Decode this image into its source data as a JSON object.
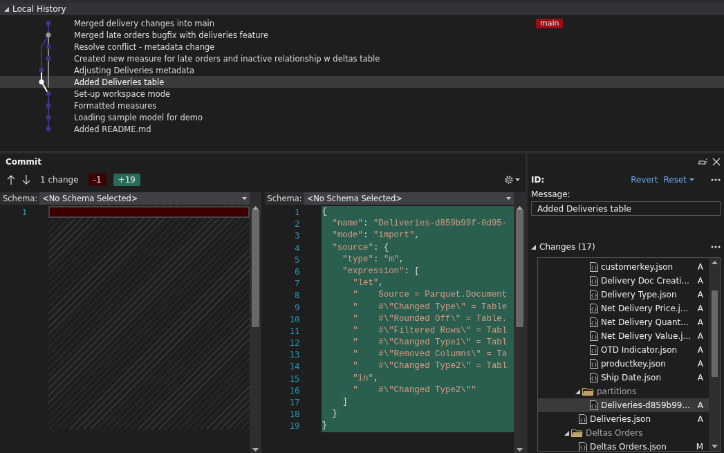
{
  "history": {
    "title": "Local History",
    "expanded": true,
    "commits": [
      {
        "message": "Merged delivery changes into main",
        "selected": false,
        "on_branch": false,
        "kind": "commit",
        "badge": "main"
      },
      {
        "message": "Merged late orders bugfix with deliveries feature",
        "selected": false,
        "on_branch": false,
        "kind": "merge"
      },
      {
        "message": "Resolve conflict - metadata change",
        "selected": false,
        "on_branch": false,
        "kind": "commit"
      },
      {
        "message": "Created new measure for late orders and inactive relationship w deltas table",
        "selected": false,
        "on_branch": false,
        "kind": "commit"
      },
      {
        "message": "Adjusting Deliveries metadata",
        "selected": false,
        "on_branch": true,
        "kind": "commit"
      },
      {
        "message": "Added Deliveries table",
        "selected": true,
        "on_branch": true,
        "kind": "commit"
      },
      {
        "message": "Set-up workspace mode",
        "selected": false,
        "on_branch": false,
        "kind": "commit"
      },
      {
        "message": "Formatted measures",
        "selected": false,
        "on_branch": false,
        "kind": "commit"
      },
      {
        "message": "Loading sample model for demo",
        "selected": false,
        "on_branch": false,
        "kind": "commit"
      },
      {
        "message": "Added README.md",
        "selected": false,
        "on_branch": false,
        "kind": "commit"
      }
    ]
  },
  "commit": {
    "title": "Commit",
    "change_count": "1 change",
    "removed": "-1",
    "added": "+19"
  },
  "diff": {
    "left": {
      "schema_label": "Schema:",
      "schema": "<No Schema Selected>",
      "lines": [
        {
          "number": "1",
          "kind": "removed"
        }
      ]
    },
    "right": {
      "schema_label": "Schema:",
      "schema": "<No Schema Selected>",
      "lines": [
        {
          "number": "1",
          "kind": "added",
          "text": "{"
        },
        {
          "number": "2",
          "kind": "added",
          "text": "  \"name\": \"Deliveries-d859b99f-0d95-"
        },
        {
          "number": "3",
          "kind": "added",
          "text": "  \"mode\": \"import\","
        },
        {
          "number": "4",
          "kind": "added",
          "text": "  \"source\": {"
        },
        {
          "number": "5",
          "kind": "added",
          "text": "    \"type\": \"m\","
        },
        {
          "number": "6",
          "kind": "added",
          "text": "    \"expression\": ["
        },
        {
          "number": "7",
          "kind": "added",
          "text": "      \"let\","
        },
        {
          "number": "8",
          "kind": "added",
          "text": "      \"    Source = Parquet.Document"
        },
        {
          "number": "9",
          "kind": "added",
          "text": "      \"    #\\\"Changed Type\\\" = Table"
        },
        {
          "number": "10",
          "kind": "added",
          "text": "      \"    #\\\"Rounded Off\\\" = Table."
        },
        {
          "number": "11",
          "kind": "added",
          "text": "      \"    #\\\"Filtered Rows\\\" = Tabl"
        },
        {
          "number": "12",
          "kind": "added",
          "text": "      \"    #\\\"Changed Type1\\\" = Tabl"
        },
        {
          "number": "13",
          "kind": "added",
          "text": "      \"    #\\\"Removed Columns\\\" = Ta"
        },
        {
          "number": "14",
          "kind": "added",
          "text": "      \"    #\\\"Changed Type2\\\" = Tabl"
        },
        {
          "number": "15",
          "kind": "added",
          "text": "      \"in\","
        },
        {
          "number": "16",
          "kind": "added",
          "text": "      \"    #\\\"Changed Type2\\\"\""
        },
        {
          "number": "17",
          "kind": "added",
          "text": "    ]"
        },
        {
          "number": "18",
          "kind": "added",
          "text": "  }"
        },
        {
          "number": "19",
          "kind": "added",
          "text": "}"
        }
      ]
    }
  },
  "details": {
    "id_label": "ID:",
    "revert": "Revert",
    "reset": "Reset",
    "message_label": "Message:",
    "message": "Added Deliveries table",
    "changes_title": "Changes (17)",
    "changes_expanded": true,
    "tree": [
      {
        "kind": "hidden-folder",
        "children": [
          {
            "kind": "hidden-folder",
            "children": [
              {
                "kind": "file",
                "name": "customerkey.json",
                "status": "A",
                "selected": false
              },
              {
                "kind": "file",
                "name": "Delivery Doc Creati...",
                "status": "A",
                "selected": false
              },
              {
                "kind": "file",
                "name": "Delivery Type.json",
                "status": "A",
                "selected": false
              },
              {
                "kind": "file",
                "name": "Net Delivery Price.j...",
                "status": "A",
                "selected": false
              },
              {
                "kind": "file",
                "name": "Net Delivery Quant...",
                "status": "A",
                "selected": false
              },
              {
                "kind": "file",
                "name": "Net Delivery Value.j...",
                "status": "A",
                "selected": false
              },
              {
                "kind": "file",
                "name": "OTD Indicator.json",
                "status": "A",
                "selected": false
              },
              {
                "kind": "file",
                "name": "productkey.json",
                "status": "A",
                "selected": false
              },
              {
                "kind": "file",
                "name": "Ship Date.json",
                "status": "A",
                "selected": false
              }
            ]
          },
          {
            "kind": "folder",
            "name": "partitions",
            "expanded": true,
            "children": [
              {
                "kind": "file",
                "name": "Deliveries-d859b99...",
                "status": "A",
                "selected": true
              }
            ]
          },
          {
            "kind": "file",
            "name": "Deliveries.json",
            "status": "A",
            "selected": false
          }
        ]
      },
      {
        "kind": "folder",
        "name": "Deltas Orders",
        "expanded": true,
        "children": [
          {
            "kind": "file",
            "name": "Deltas Orders.json",
            "status": "M",
            "selected": false
          }
        ]
      }
    ]
  }
}
